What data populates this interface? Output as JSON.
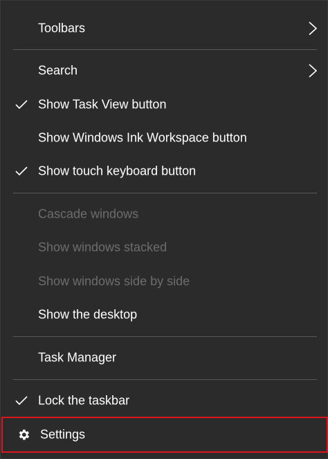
{
  "menu": {
    "items": [
      {
        "label": "Toolbars",
        "checked": false,
        "submenu": true,
        "enabled": true
      },
      {
        "label": "Search",
        "checked": false,
        "submenu": true,
        "enabled": true
      },
      {
        "label": "Show Task View button",
        "checked": true,
        "submenu": false,
        "enabled": true
      },
      {
        "label": "Show Windows Ink Workspace button",
        "checked": false,
        "submenu": false,
        "enabled": true
      },
      {
        "label": "Show touch keyboard button",
        "checked": true,
        "submenu": false,
        "enabled": true
      },
      {
        "label": "Cascade windows",
        "checked": false,
        "submenu": false,
        "enabled": false
      },
      {
        "label": "Show windows stacked",
        "checked": false,
        "submenu": false,
        "enabled": false
      },
      {
        "label": "Show windows side by side",
        "checked": false,
        "submenu": false,
        "enabled": false
      },
      {
        "label": "Show the desktop",
        "checked": false,
        "submenu": false,
        "enabled": true
      },
      {
        "label": "Task Manager",
        "checked": false,
        "submenu": false,
        "enabled": true
      },
      {
        "label": "Lock the taskbar",
        "checked": true,
        "submenu": false,
        "enabled": true
      },
      {
        "label": "Settings",
        "checked": false,
        "submenu": false,
        "enabled": true,
        "icon": "gear-icon",
        "highlighted": true
      }
    ]
  },
  "colors": {
    "background": "#2b2b2b",
    "text": "#ffffff",
    "disabled_text": "#6d6d6d",
    "separator": "#5a5a5a",
    "highlight_border": "#e0141e"
  }
}
